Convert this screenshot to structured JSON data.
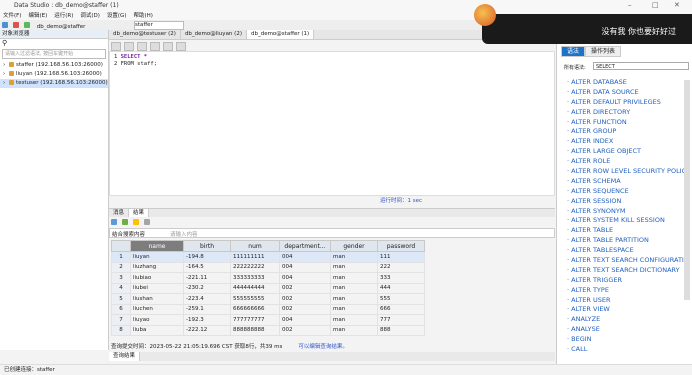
{
  "window": {
    "title": "Data Studio : db_demo@staffer (1)",
    "min": "–",
    "max": "□",
    "close": "✕"
  },
  "menu": [
    "文件(F)",
    "编辑(E)",
    "运行(R)",
    "调试(D)",
    "设置(G)",
    "帮助(H)"
  ],
  "toolbar": {
    "connection": "db_demo@staffer",
    "user": "staffer"
  },
  "left_panel": {
    "header": "对象浏览器",
    "filter_placeholder": "请输入过滤语法, 按回车键开始",
    "connections": [
      "staffer (192.168.56.103:26000)",
      "liuyan (192.168.56.103:26000)",
      "testuser (192.168.56.103:26000)"
    ]
  },
  "tabs": [
    "db_demo@testuser (2)",
    "db_demo@liuyan (2)",
    "db_demo@staffer (1)"
  ],
  "editor": {
    "line1": "SELECT *",
    "line2": "FROM staff;"
  },
  "run_time": "运行时间：1 sec",
  "results": {
    "tabs": [
      "消息",
      "结果"
    ],
    "filter_label": "结合搜索内容",
    "filter_placeholder": "请输入内容",
    "columns": [
      "name",
      "birth",
      "num",
      "department...",
      "gender",
      "password"
    ],
    "rows": [
      [
        "liuyan",
        "-194.8",
        "111111111",
        "004",
        "man",
        "111"
      ],
      [
        "liuzhang",
        "-164.5",
        "222222222",
        "004",
        "man",
        "222"
      ],
      [
        "liubiao",
        "-221.11",
        "333333333",
        "004",
        "man",
        "333"
      ],
      [
        "liubei",
        "-230.2",
        "444444444",
        "002",
        "man",
        "444"
      ],
      [
        "liushan",
        "-223.4",
        "555555555",
        "002",
        "man",
        "555"
      ],
      [
        "liuchen",
        "-259.1",
        "666666666",
        "002",
        "man",
        "666"
      ],
      [
        "liuyao",
        "-192.3",
        "777777777",
        "004",
        "man",
        "777"
      ],
      [
        "liuba",
        "-222.12",
        "888888888",
        "002",
        "man",
        "888"
      ]
    ],
    "status": "查询提交时间：2023-05-22 21:05:19.696 CST   获取8行，共39 ms",
    "status_link": "可以编辑查询结果。",
    "bottom_tab": "查询结果"
  },
  "statusbar": "已创建连接：staffer",
  "overlay_text": "没有我 你也要好好过",
  "right_panel": {
    "tabs": [
      "语法",
      "操作列表"
    ],
    "label": "所有语法:",
    "select": "SELECT",
    "keywords": [
      "ALTER DATABASE",
      "ALTER DATA SOURCE",
      "ALTER DEFAULT PRIVILEGES",
      "ALTER DIRECTORY",
      "ALTER FUNCTION",
      "ALTER GROUP",
      "ALTER INDEX",
      "ALTER LARGE OBJECT",
      "ALTER ROLE",
      "ALTER ROW LEVEL SECURITY POLICY",
      "ALTER SCHEMA",
      "ALTER SEQUENCE",
      "ALTER SESSION",
      "ALTER SYNONYM",
      "ALTER SYSTEM KILL SESSION",
      "ALTER TABLE",
      "ALTER TABLE PARTITION",
      "ALTER TABLESPACE",
      "ALTER TEXT SEARCH CONFIGURATIC",
      "ALTER TEXT SEARCH DICTIONARY",
      "ALTER TRIGGER",
      "ALTER TYPE",
      "ALTER USER",
      "ALTER VIEW",
      "ANALYZE",
      "ANALYSE",
      "BEGIN",
      "CALL"
    ]
  }
}
